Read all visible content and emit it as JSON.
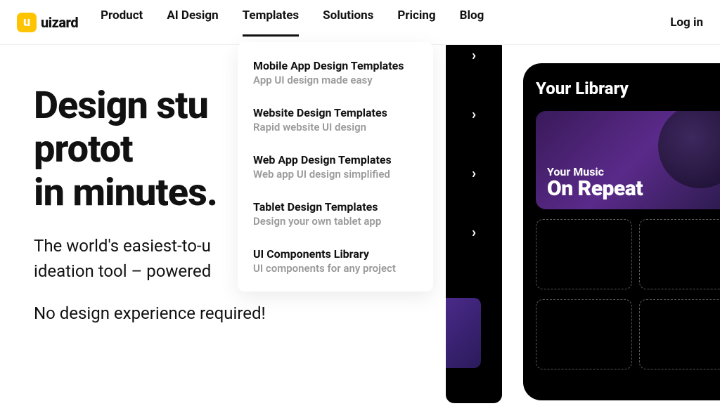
{
  "brand": {
    "name": "uizard",
    "mark": "u"
  },
  "nav": {
    "items": [
      {
        "label": "Product"
      },
      {
        "label": "AI Design"
      },
      {
        "label": "Templates"
      },
      {
        "label": "Solutions"
      },
      {
        "label": "Pricing"
      },
      {
        "label": "Blog"
      }
    ],
    "login": "Log in"
  },
  "dropdown": {
    "items": [
      {
        "title": "Mobile App Design Templates",
        "sub": "App UI design made easy"
      },
      {
        "title": "Website Design Templates",
        "sub": "Rapid website UI design"
      },
      {
        "title": "Web App Design Templates",
        "sub": "Web app UI design simplified"
      },
      {
        "title": "Tablet Design Templates",
        "sub": "Design your own tablet app"
      },
      {
        "title": "UI Components Library",
        "sub": "UI components for any project"
      }
    ]
  },
  "hero": {
    "h1_line1": "Design stu",
    "h1_line2": "protot",
    "h1_line3": "in minutes.",
    "p1": "The world's easiest-to-u\nideation tool – powered",
    "p2": "No design experience required!"
  },
  "preview": {
    "library_title": "Your Library",
    "music_small": "Your Music",
    "music_big": "On Repeat"
  }
}
